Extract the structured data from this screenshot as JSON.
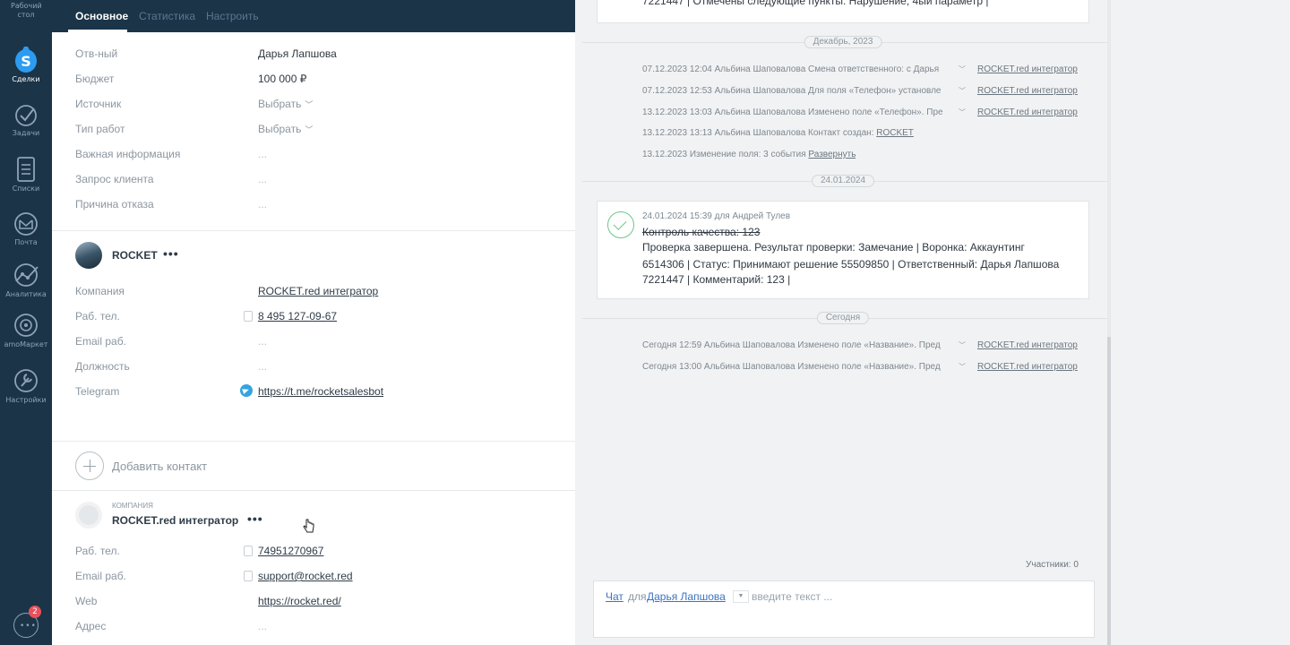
{
  "nav": {
    "items": [
      {
        "label": "Рабочий стол",
        "icon": "desktop-icon"
      },
      {
        "label": "Сделки",
        "icon": "deals-icon",
        "active": true
      },
      {
        "label": "Задачи",
        "icon": "tasks-icon"
      },
      {
        "label": "Списки",
        "icon": "lists-icon"
      },
      {
        "label": "Почта",
        "icon": "mail-icon"
      },
      {
        "label": "Аналитика",
        "icon": "analytics-icon"
      },
      {
        "label": "amoМаркет",
        "icon": "market-icon"
      },
      {
        "label": "Настройки",
        "icon": "settings-icon"
      }
    ],
    "chat_badge": "2"
  },
  "card": {
    "tabs": [
      {
        "label": "Основное",
        "active": true
      },
      {
        "label": "Статистика"
      },
      {
        "label": "Настроить"
      }
    ],
    "fields": [
      {
        "label": "Отв-ный",
        "value": "Дарья Лапшова"
      },
      {
        "label": "Бюджет",
        "value": "100 000  ₽"
      },
      {
        "label": "Источник",
        "value": "Выбрать"
      },
      {
        "label": "Тип работ",
        "value": "Выбрать"
      },
      {
        "label": "Важная информация",
        "value": "..."
      },
      {
        "label": "Запрос клиента",
        "value": "..."
      },
      {
        "label": "Причина отказа",
        "value": "..."
      }
    ],
    "contact": {
      "name": "ROCKET",
      "more": "•••",
      "fields": [
        {
          "label": "Компания",
          "value": "ROCKET.red интегратор"
        },
        {
          "label": "Раб. тел.",
          "value": "8 495 127-09-67"
        },
        {
          "label": "Email раб.",
          "value": "..."
        },
        {
          "label": "Должность",
          "value": "..."
        },
        {
          "label": "Telegram",
          "value": "https://t.me/rocketsalesbot"
        }
      ]
    },
    "add_contact": "Добавить контакт",
    "company": {
      "tag": "КОМПАНИЯ",
      "name": "ROCKET.red интегратор",
      "more": "•••",
      "fields": [
        {
          "label": "Раб. тел.",
          "value": "74951270967"
        },
        {
          "label": "Email раб.",
          "value": "support@rocket.red"
        },
        {
          "label": "Web",
          "value": "https://rocket.red/"
        },
        {
          "label": "Адрес",
          "value": "..."
        }
      ]
    }
  },
  "feed": {
    "top_note": "7221447 | Отмечены следующие пункты: Нарушение, 4ый параметр |",
    "groups": [
      {
        "date": "Декабрь, 2023",
        "events": [
          {
            "text": "07.12.2023 12:04 Альбина Шаповалова Смена ответственного: с Дарья",
            "link": "ROCKET.red интегратор"
          },
          {
            "text": "07.12.2023 12:53 Альбина Шаповалова Для поля «Телефон» установле",
            "link": "ROCKET.red интегратор"
          },
          {
            "text": "13.12.2023 13:03 Альбина Шаповалова Изменено поле «Телефон». Пре",
            "link": "ROCKET.red интегратор"
          },
          {
            "text": "13.12.2023 13:13 Альбина Шаповалова Контакт создан: ",
            "inline_link": "ROCKET"
          },
          {
            "text": "13.12.2023 Изменение поля: 3 события ",
            "inline_link": "Развернуть"
          }
        ]
      },
      {
        "date": "24.01.2024"
      },
      {
        "date": "Сегодня",
        "events": [
          {
            "text": "Сегодня 12:59 Альбина Шаповалова Изменено поле «Название». Пред",
            "link": "ROCKET.red интегратор"
          },
          {
            "text": "Сегодня 13:00 Альбина Шаповалова Изменено поле «Название». Пред",
            "link": "ROCKET.red интегратор"
          }
        ]
      }
    ],
    "task": {
      "meta": "24.01.2024 15:39  для Андрей Тулев",
      "title": "Контроль качества: 123",
      "lines": [
        "Проверка завершена. Результат проверки: Замечание | Воронка: Аккаунтинг",
        "6514306 | Статус: Принимают решение 55509850 | Ответственный: Дарья Лапшова",
        "7221447 | Комментарий: 123 |"
      ]
    },
    "participants": "Участники: 0",
    "composer": {
      "chat": "Чат",
      "for": "для",
      "user": "Дарья Лапшова",
      "placeholder": "введите текст ..."
    }
  }
}
